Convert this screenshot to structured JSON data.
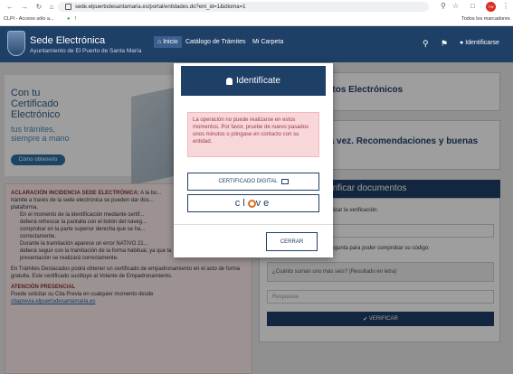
{
  "browser": {
    "url": "sede.elpuertodesantamaria.es/portal/entidades.do?ent_id=1&idioma=1",
    "bookmarks": [
      "CLPI - Acceso sólo a...",
      "!"
    ],
    "all_bookmarks": "Todos los marcadores",
    "profile": "TW"
  },
  "header": {
    "title": "Sede Electrónica",
    "subtitle": "Ayuntamiento de El Puerto de Santa María",
    "menu": [
      "Inicio",
      "Catálogo de Trámites",
      "Mi Carpeta"
    ],
    "ident": "Identificarse"
  },
  "banner": {
    "lines": [
      "Con tu",
      "Certificado",
      "Electrónico"
    ],
    "tagline": [
      "tus trámites,",
      "siempre a mano"
    ],
    "button": "Cómo obtenerlo",
    "key": "Iniciar Trámites"
  },
  "notice": {
    "heading": "ACLARACIÓN INCIDENCIA SEDE ELECTRÓNICA:",
    "lines": [
      "A la bo...",
      "trámite a través de la sede electrónica se pueden dar dos...",
      "plataforma.",
      "En el momento de la identificación mediante certif...",
      "deberá refrescar la pantalla con el botón del naveg...",
      "comprobar en la parte superior derecha que se ha...",
      "correctamente.",
      "Durante la tramitación aparece un error NATIVO 21...",
      "deberá seguir con la tramitación de la forma habitual, ya que la",
      "presentación se realizará correctamente."
    ],
    "para": "En Trámites Destacados podrá obtener un certificado de empadronamiento en el acto de forma gratuita. Este certificado sustituye al Volante de Empadronamiento.",
    "attention": "ATENCIÓN PRESENCIAL",
    "cita": "Puede solicitar su Cita Previa en cualquier momento desde",
    "cita_link": "citaprevia.elpuertodesantamaria.es"
  },
  "cards": {
    "edictos": "Tablón de Edictos Electrónicos",
    "primera": "¿Es su primera vez. Recomendaciones y buenas prácticas",
    "docs_title": "Verificar documentos",
    "docs_intro": "Introduzca el CSV para realizar la verificación:",
    "csv_placeholder": "Código de verificación",
    "question_intro": "Responda a la siguiente pregunta para poder comprobar su código:",
    "question": "¿Cuánto suman uno más seis? (Resultado en letra)",
    "answer_placeholder": "Respuesta",
    "verify": "VERIFICAR"
  },
  "modal": {
    "title": "Identifícate",
    "alert": "La operación no puede realizarse en estos momentos. Por favor, pruebe de nuevo pasados unos minutos o póngase en contacto con su entidad.",
    "cert_button": "CERTIFICADO DIGITAL",
    "clave": [
      "cl",
      "ve"
    ],
    "close": "CERRAR"
  },
  "colors": {
    "primary": "#1e3f66",
    "alert_bg": "#f8d7da",
    "clave_accent": "#e36a1c"
  }
}
